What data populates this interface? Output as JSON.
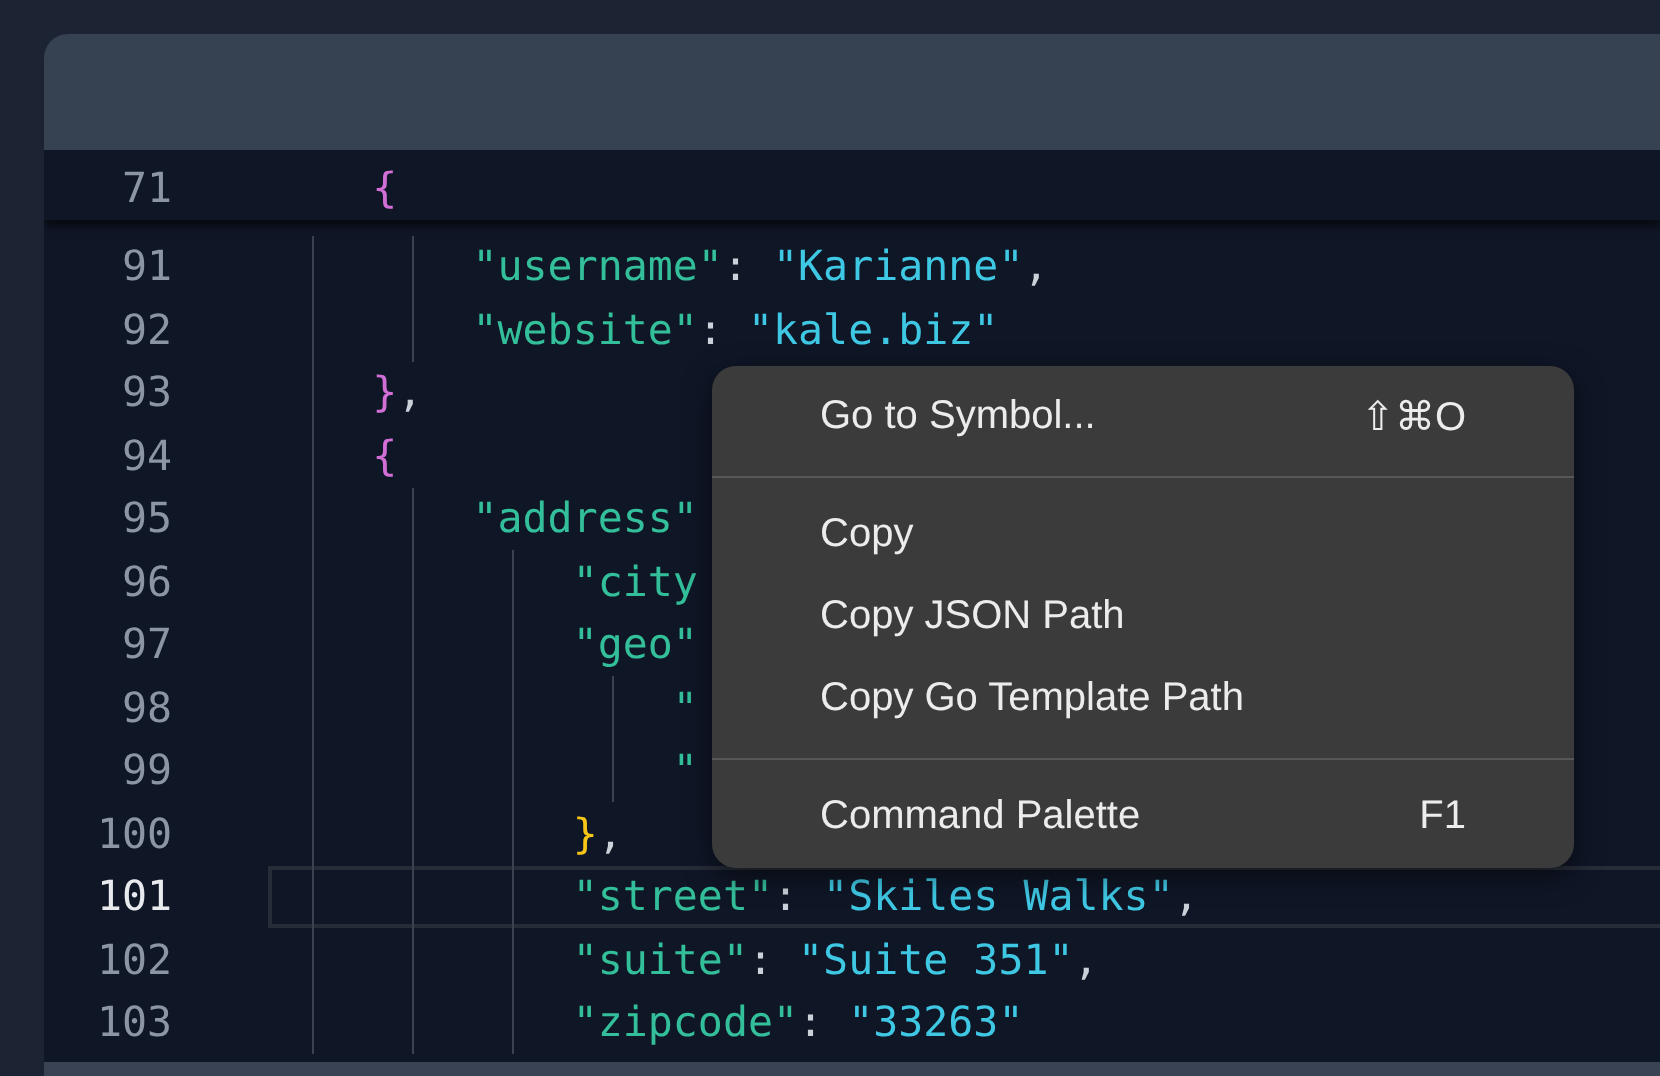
{
  "editor": {
    "sticky_line": {
      "number": "71",
      "tokens": [
        {
          "kind": "bracket",
          "text": "        {",
          "color": "#d16fd6"
        }
      ]
    },
    "lines": [
      {
        "number": "91",
        "current": false,
        "tokens": [
          {
            "kind": "key",
            "text": "            \"username\""
          },
          {
            "kind": "punct",
            "text": ": "
          },
          {
            "kind": "string",
            "text": "\"Karianne\""
          },
          {
            "kind": "punct",
            "text": ","
          }
        ]
      },
      {
        "number": "92",
        "current": false,
        "tokens": [
          {
            "kind": "key",
            "text": "            \"website\""
          },
          {
            "kind": "punct",
            "text": ": "
          },
          {
            "kind": "string",
            "text": "\"kale.biz\""
          }
        ]
      },
      {
        "number": "93",
        "current": false,
        "tokens": [
          {
            "kind": "bracket",
            "text": "        }",
            "color": "#d16fd6"
          },
          {
            "kind": "punct",
            "text": ","
          }
        ]
      },
      {
        "number": "94",
        "current": false,
        "tokens": [
          {
            "kind": "bracket",
            "text": "        {",
            "color": "#d16fd6"
          }
        ]
      },
      {
        "number": "95",
        "current": false,
        "tokens": [
          {
            "kind": "key",
            "text": "            \"address\""
          }
        ]
      },
      {
        "number": "96",
        "current": false,
        "tokens": [
          {
            "kind": "key",
            "text": "                \"city"
          }
        ]
      },
      {
        "number": "97",
        "current": false,
        "tokens": [
          {
            "kind": "key",
            "text": "                \"geo\""
          }
        ]
      },
      {
        "number": "98",
        "current": false,
        "tokens": [
          {
            "kind": "key",
            "text": "                    \""
          }
        ]
      },
      {
        "number": "99",
        "current": false,
        "tokens": [
          {
            "kind": "key",
            "text": "                    \""
          }
        ]
      },
      {
        "number": "100",
        "current": false,
        "tokens": [
          {
            "kind": "bracket",
            "text": "                }",
            "color": "#f5c518"
          },
          {
            "kind": "punct",
            "text": ","
          }
        ]
      },
      {
        "number": "101",
        "current": true,
        "tokens": [
          {
            "kind": "key",
            "text": "                \"street\""
          },
          {
            "kind": "punct",
            "text": ": "
          },
          {
            "kind": "string",
            "text": "\"Skiles Walks\""
          },
          {
            "kind": "punct",
            "text": ","
          }
        ]
      },
      {
        "number": "102",
        "current": false,
        "tokens": [
          {
            "kind": "key",
            "text": "                \"suite\""
          },
          {
            "kind": "punct",
            "text": ": "
          },
          {
            "kind": "string",
            "text": "\"Suite 351\""
          },
          {
            "kind": "punct",
            "text": ","
          }
        ]
      },
      {
        "number": "103",
        "current": false,
        "tokens": [
          {
            "kind": "key",
            "text": "                \"zipcode\""
          },
          {
            "kind": "punct",
            "text": ": "
          },
          {
            "kind": "string",
            "text": "\"33263\""
          }
        ]
      }
    ]
  },
  "context_menu": {
    "items": [
      {
        "kind": "item",
        "label": "Go to Symbol...",
        "shortcut": "⇧⌘O"
      },
      {
        "kind": "separator"
      },
      {
        "kind": "item",
        "label": "Copy"
      },
      {
        "kind": "item",
        "label": "Copy JSON Path"
      },
      {
        "kind": "item",
        "label": "Copy Go Template Path"
      },
      {
        "kind": "separator"
      },
      {
        "kind": "item",
        "label": "Command Palette",
        "shortcut": "F1"
      }
    ]
  }
}
